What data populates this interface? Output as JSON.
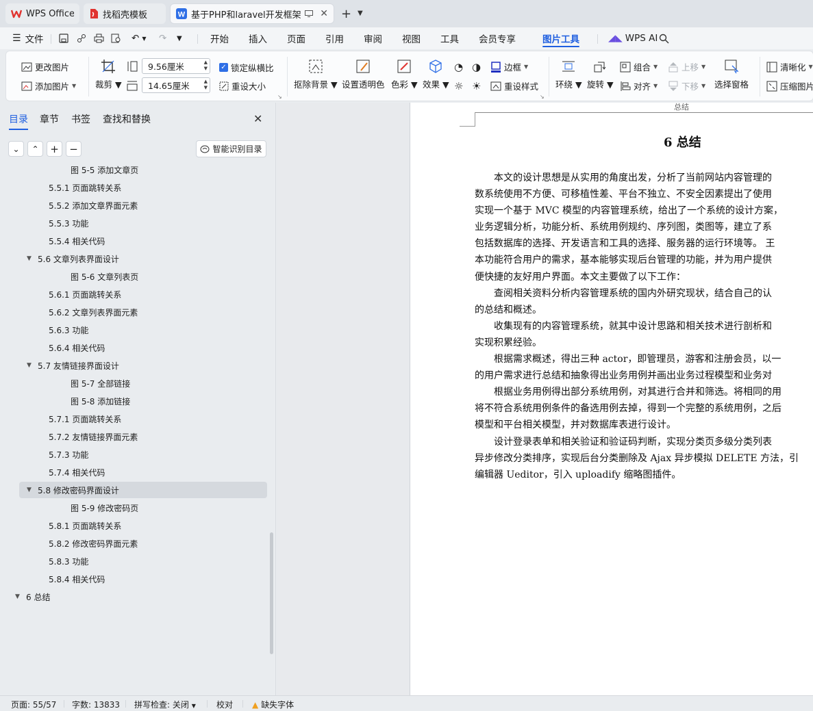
{
  "tabs": [
    {
      "label": "WPS Office",
      "icon": "wps-logo-icon"
    },
    {
      "label": "找稻壳模板",
      "icon": "docer-icon"
    },
    {
      "label": "基于PHP和laravel开发框架的C",
      "icon": "word-doc-icon"
    }
  ],
  "menu": {
    "file": "文件",
    "items": [
      "开始",
      "插入",
      "页面",
      "引用",
      "审阅",
      "视图",
      "工具",
      "会员专享",
      "图片工具"
    ],
    "active": "图片工具",
    "ai": "WPS AI"
  },
  "ribbon": {
    "change_picture": "更改图片",
    "add_picture": "添加图片",
    "crop": "裁剪",
    "width_value": "9.56厘米",
    "height_value": "14.65厘米",
    "lock_ratio": "锁定纵横比",
    "reset_size": "重设大小",
    "remove_bg": "抠除背景",
    "set_transparent": "设置透明色",
    "color": "色彩",
    "effect": "效果",
    "border": "边框",
    "reset_style": "重设样式",
    "wrap": "环绕",
    "rotate": "旋转",
    "group": "组合",
    "align": "对齐",
    "move_up": "上移",
    "move_down": "下移",
    "selection_pane": "选择窗格",
    "sharpen": "清晰化",
    "compress": "压缩图片"
  },
  "nav": {
    "tabs": [
      "目录",
      "章节",
      "书签",
      "查找和替换"
    ],
    "active_tab": "目录",
    "smart_toc": "智能识别目录",
    "toc": [
      {
        "text": "图 5-5  添加文章页",
        "level": 3
      },
      {
        "text": "5.5.1 页面跳转关系",
        "level": 2
      },
      {
        "text": "5.5.2 添加文章界面元素",
        "level": 2
      },
      {
        "text": "5.5.3 功能",
        "level": 2
      },
      {
        "text": "5.5.4 相关代码",
        "level": 2
      },
      {
        "text": "5.6 文章列表界面设计",
        "level": 1,
        "expanded": true
      },
      {
        "text": "图 5-6  文章列表页",
        "level": 3
      },
      {
        "text": "5.6.1 页面跳转关系",
        "level": 2
      },
      {
        "text": "5.6.2 文章列表界面元素",
        "level": 2
      },
      {
        "text": "5.6.3 功能",
        "level": 2
      },
      {
        "text": "5.6.4 相关代码",
        "level": 2
      },
      {
        "text": "5.7 友情链接界面设计",
        "level": 1,
        "expanded": true
      },
      {
        "text": "图 5-7  全部链接",
        "level": 3
      },
      {
        "text": "图 5-8  添加链接",
        "level": 3
      },
      {
        "text": "5.7.1 页面跳转关系",
        "level": 2
      },
      {
        "text": "5.7.2 友情链接界面元素",
        "level": 2
      },
      {
        "text": "5.7.3 功能",
        "level": 2
      },
      {
        "text": "5.7.4 相关代码",
        "level": 2
      },
      {
        "text": "5.8 修改密码界面设计",
        "level": 1,
        "expanded": true,
        "selected": true
      },
      {
        "text": "图 5-9  修改密码页",
        "level": 3
      },
      {
        "text": "5.8.1 页面跳转关系",
        "level": 2
      },
      {
        "text": "5.8.2 修改密码界面元素",
        "level": 2
      },
      {
        "text": "5.8.3 功能",
        "level": 2
      },
      {
        "text": "5.8.4 相关代码",
        "level": 2
      },
      {
        "text": "6  总结",
        "level": 0,
        "expanded": true
      }
    ]
  },
  "document": {
    "header": "总结",
    "title": "6  总结",
    "lines": [
      "　　本文的设计思想是从实用的角度出发，分析了当前网站内容管理的",
      "数系统使用不方便、可移植性差、平台不独立、不安全因素提出了使用",
      "实现一个基于 MVC 模型的内容管理系统，给出了一个系统的设计方案，",
      "业务逻辑分析，功能分析、系统用例规约、序列图，类图等，建立了系",
      "包括数据库的选择、开发语言和工具的选择、服务器的运行环境等。 王",
      "本功能符合用户的需求，基本能够实现后台管理的功能，并为用户提供",
      "便快捷的友好用户界面。本文主要做了以下工作：",
      "　　查阅相关资料分析内容管理系统的国内外研究现状，结合自己的认",
      "的总结和概述。",
      "　　收集现有的内容管理系统，就其中设计思路和相关技术进行剖析和",
      "实现积累经验。",
      "　　根据需求概述，得出三种 actor，即管理员，游客和注册会员，以一",
      "的用户需求进行总结和抽象得出业务用例并画出业务过程模型和业务对",
      "　　根据业务用例得出部分系统用例，对其进行合并和筛选。将相同的用",
      "将不符合系统用例条件的备选用例去掉，得到一个完整的系统用例，之后",
      "模型和平台相关模型，并对数据库表进行设计。",
      "　　设计登录表单和相关验证和验证码判断，实现分类页多级分类列表",
      "异步修改分类排序，实现后台分类删除及 Ajax 异步模拟 DELETE 方法，引",
      "编辑器 Ueditor，引入 uploadify 缩略图插件。"
    ]
  },
  "status": {
    "page": "页面: 55/57",
    "words": "字数: 13833",
    "spell": "拼写检查: 关闭",
    "proof": "校对",
    "missing_font": "缺失字体"
  },
  "colors": {
    "accent": "#1f5fe0",
    "wps_red": "#e0332f",
    "warning": "#f0a020"
  }
}
